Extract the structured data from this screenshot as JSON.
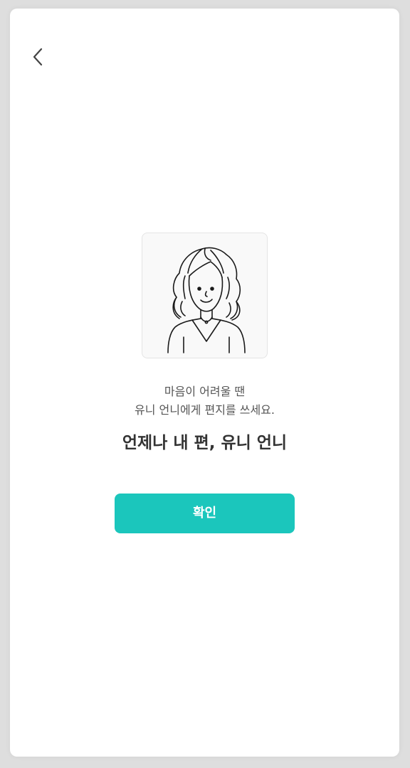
{
  "header": {
    "back_icon": "chevron-left-icon"
  },
  "illustration": {
    "icon": "woman-portrait-icon"
  },
  "message": {
    "line1": "마음이 어려울 땐",
    "line2": "유니 언니에게 편지를 쓰세요."
  },
  "tagline": "언제나 내 편, 유니 언니",
  "actions": {
    "confirm_label": "확인"
  },
  "colors": {
    "accent": "#1bc6bc",
    "background": "#ffffff",
    "text": "#555555",
    "title": "#333333"
  }
}
